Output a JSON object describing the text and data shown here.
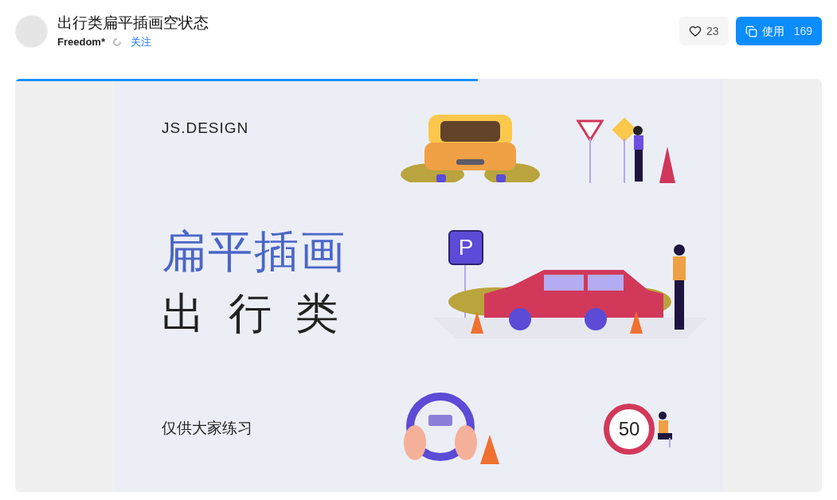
{
  "header": {
    "title": "出行类扁平插画空状态",
    "author": "Freedom*",
    "follow": "关注",
    "likes": "23",
    "use_label": "使用",
    "use_count": "169"
  },
  "loading": {
    "level": 0.574
  },
  "preview": {
    "brand": "JS.DESIGN",
    "headline": "扁平插画",
    "subtitle": "出  行  类",
    "note": "仅供大家练习",
    "parking_sign": "P",
    "speed_sign": "50"
  }
}
